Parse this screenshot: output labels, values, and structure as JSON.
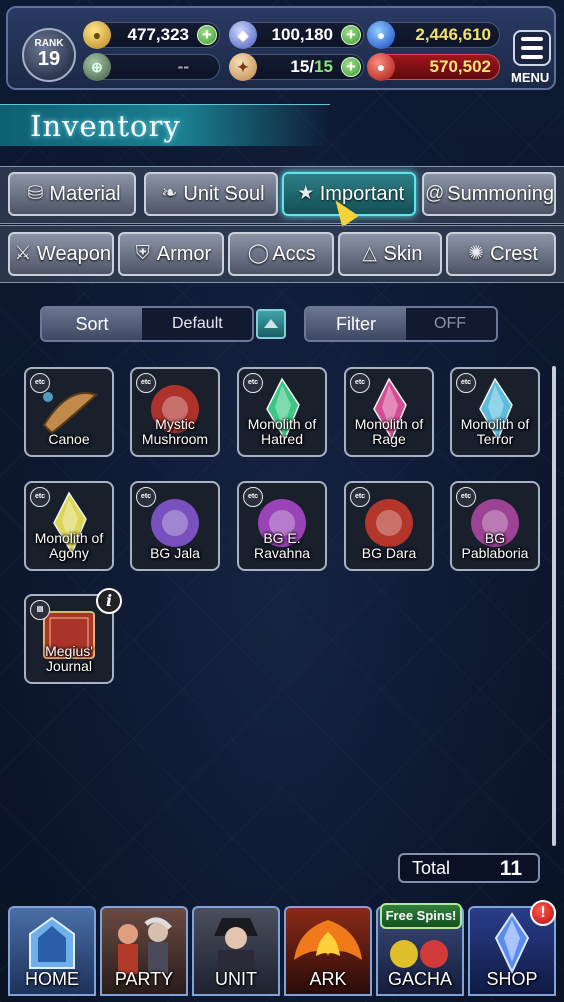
{
  "status": {
    "rank_label": "RANK",
    "rank_value": "19",
    "gold": "477,323",
    "crystals": "100,180",
    "blue_orbs": "2,446,610",
    "guild_value": "--",
    "stamina": "15",
    "stamina_max": "15",
    "red_points": "570,502",
    "menu_label": "MENU"
  },
  "title": "Inventory",
  "tabs_row1": [
    {
      "label": "Material",
      "icon": "bag-icon"
    },
    {
      "label": "Unit Soul",
      "icon": "flame-icon"
    },
    {
      "label": "Important",
      "icon": "star-icon",
      "active": true
    },
    {
      "label": "Summoning",
      "icon": "swirl-icon"
    }
  ],
  "tabs_row2": [
    {
      "label": "Weapon",
      "icon": "sword-icon"
    },
    {
      "label": "Armor",
      "icon": "armor-icon"
    },
    {
      "label": "Accs",
      "icon": "ring-icon"
    },
    {
      "label": "Skin",
      "icon": "hanger-icon"
    },
    {
      "label": "Crest",
      "icon": "crest-icon"
    }
  ],
  "sort": {
    "label": "Sort",
    "value": "Default"
  },
  "filter": {
    "label": "Filter",
    "value": "OFF"
  },
  "items": [
    {
      "name": "Canoe",
      "badge": "etc",
      "color": "#c08a4a"
    },
    {
      "name": "Mystic Mushroom",
      "badge": "etc",
      "color": "#c9362c"
    },
    {
      "name": "Monolith of Hatred",
      "badge": "etc",
      "color": "#3fd08a"
    },
    {
      "name": "Monolith of Rage",
      "badge": "etc",
      "color": "#e0509a"
    },
    {
      "name": "Monolith of Terror",
      "badge": "etc",
      "color": "#5fc6e8"
    },
    {
      "name": "Monolith of Agony",
      "badge": "etc",
      "color": "#e6e05a"
    },
    {
      "name": "BG Jala",
      "badge": "etc",
      "color": "#8a5ad8"
    },
    {
      "name": "BG E. Ravahna",
      "badge": "etc",
      "color": "#b04ad0"
    },
    {
      "name": "BG Dara",
      "badge": "etc",
      "color": "#d03a2a"
    },
    {
      "name": "BG Pablaboria",
      "badge": "etc",
      "color": "#b54aa8"
    },
    {
      "name": "Megius' Journal",
      "badge": "book",
      "color": "#a8342a"
    }
  ],
  "total": {
    "label": "Total",
    "value": "11"
  },
  "nav": [
    {
      "label": "HOME"
    },
    {
      "label": "PARTY"
    },
    {
      "label": "UNIT"
    },
    {
      "label": "ARK"
    },
    {
      "label": "GACHA"
    },
    {
      "label": "SHOP"
    }
  ],
  "free_spins": "Free Spins!",
  "alert_mark": "!",
  "info_mark": "i"
}
